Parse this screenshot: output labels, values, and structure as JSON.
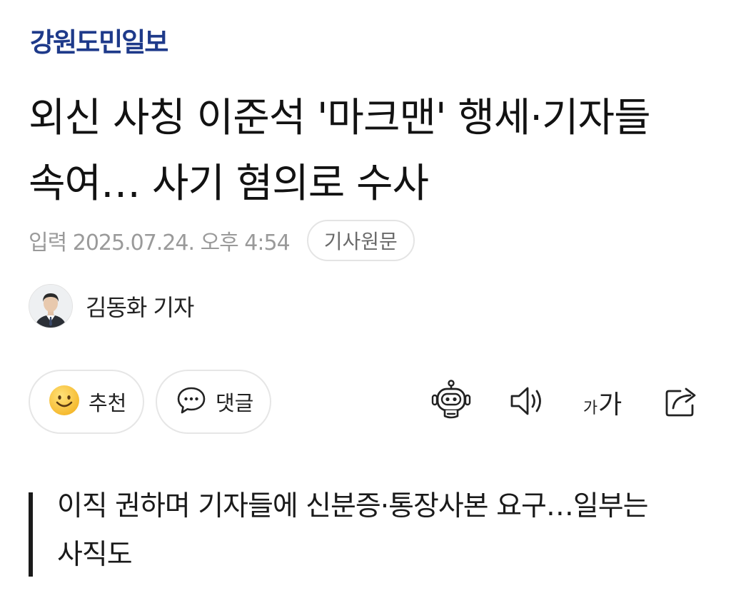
{
  "brand": {
    "name": "강원도민일보",
    "color": "#1e3a8a"
  },
  "article": {
    "headline": "외신 사칭 이준석 '마크맨' 행세·기자들 속여… 사기 혐의로 수사",
    "published": "입력 2025.07.24. 오후 4:54",
    "source_button": "기사원문",
    "reporter": "김동화 기자",
    "subheadline": "이직 권하며 기자들에 신분증·통장사본 요구…일부는 사직도"
  },
  "actions": {
    "recommend": {
      "label": "추천",
      "icon": "smile-emoji-icon"
    },
    "comment": {
      "label": "댓글",
      "icon": "speech-bubble-icon"
    }
  },
  "tools": {
    "summary_bot": {
      "icon": "robot-icon"
    },
    "read_aloud": {
      "icon": "speaker-icon"
    },
    "font_size": {
      "small": "가",
      "large": "가",
      "icon": "font-size-icon"
    },
    "share": {
      "icon": "share-icon"
    }
  }
}
